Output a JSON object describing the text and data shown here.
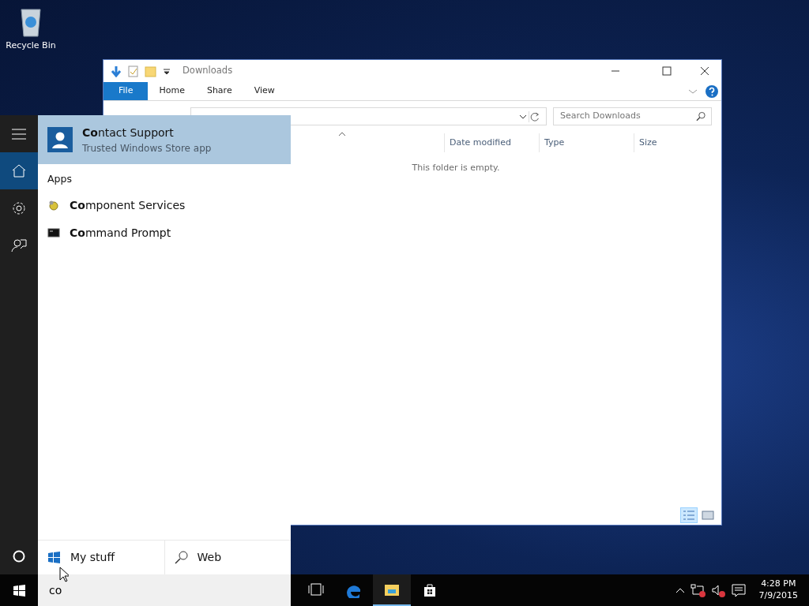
{
  "desktop": {
    "icons": [
      {
        "kind": "recycle_bin",
        "label": "Recycle Bin"
      }
    ]
  },
  "explorer": {
    "title": "Downloads",
    "ribbon_tabs": [
      {
        "kind": "file",
        "label": "File"
      },
      {
        "kind": "tab",
        "label": "Home"
      },
      {
        "kind": "tab",
        "label": "Share"
      },
      {
        "kind": "tab",
        "label": "View"
      }
    ],
    "search": {
      "placeholder": "Search Downloads"
    },
    "columns": [
      "Date modified",
      "Type",
      "Size"
    ],
    "empty_message": "This folder is empty.",
    "views": [
      {
        "kind": "details",
        "selected": true
      },
      {
        "kind": "tiles",
        "selected": false
      }
    ]
  },
  "start": {
    "rail": [
      {
        "kind": "menu",
        "selected": false
      },
      {
        "kind": "home",
        "selected": true
      },
      {
        "kind": "settings",
        "selected": false
      },
      {
        "kind": "feedback",
        "selected": false
      }
    ],
    "top_result": {
      "title": "**Co**ntact Support",
      "subtitle": "Trusted Windows Store app",
      "selected": true
    },
    "section": "Apps",
    "results": [
      {
        "kind": "component",
        "label": "**Co**mponent Services"
      },
      {
        "kind": "console",
        "label": "**Co**mmand Prompt"
      }
    ],
    "scopes": [
      {
        "kind": "windows",
        "label": "My stuff"
      },
      {
        "kind": "web",
        "label": "Web"
      }
    ]
  },
  "taskbar": {
    "search": {
      "value": "co"
    },
    "apps": [
      {
        "kind": "task_view",
        "active": false
      },
      {
        "kind": "edge",
        "active": false
      },
      {
        "kind": "explorer",
        "active": true
      },
      {
        "kind": "store",
        "active": false
      }
    ],
    "clock": {
      "time": "4:28 PM",
      "date": "7/9/2015"
    }
  }
}
